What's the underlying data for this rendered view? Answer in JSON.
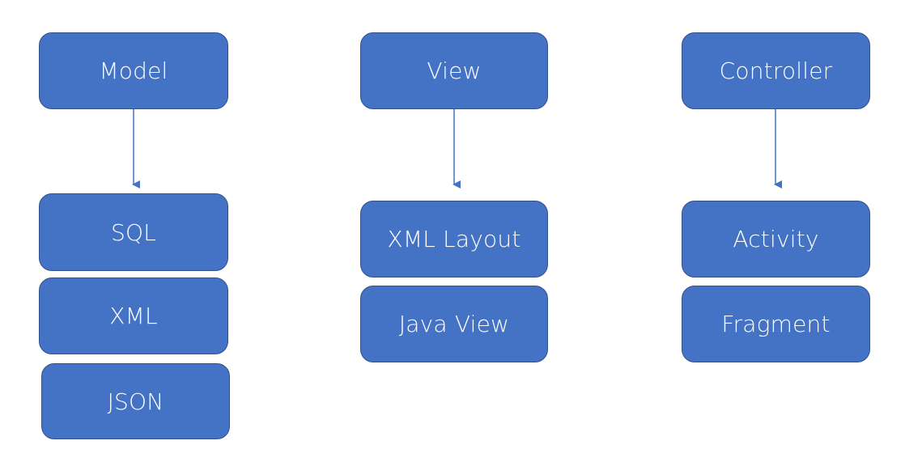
{
  "colors": {
    "box_fill": "#4472c4",
    "box_border": "#2f528f",
    "text": "#ffffff",
    "arrow": "#4472c4"
  },
  "columns": [
    {
      "header": "Model",
      "items": [
        "SQL",
        "XML",
        "JSON"
      ]
    },
    {
      "header": "View",
      "items": [
        "XML Layout",
        "Java View"
      ]
    },
    {
      "header": "Controller",
      "items": [
        "Activity",
        "Fragment"
      ]
    }
  ]
}
